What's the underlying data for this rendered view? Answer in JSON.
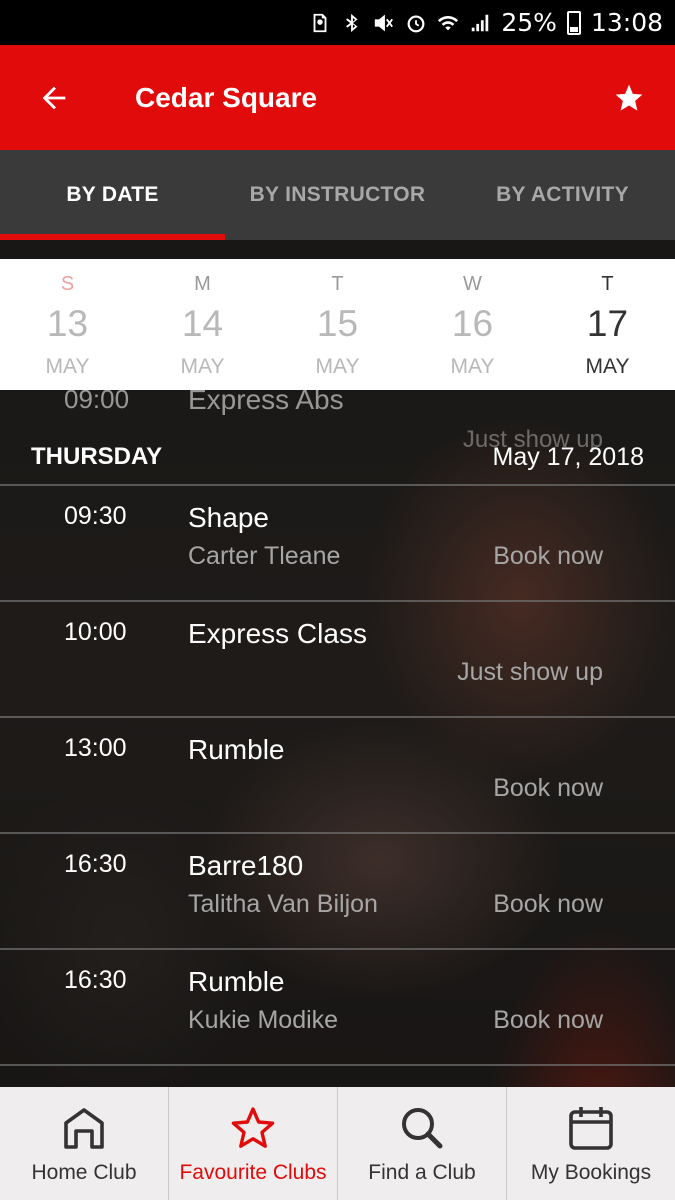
{
  "status_bar": {
    "battery": "25%",
    "time": "13:08",
    "icons": [
      "sim-alert-icon",
      "bluetooth-icon",
      "mute-icon",
      "alarm-icon",
      "wifi-icon",
      "signal-icon",
      "battery-icon"
    ]
  },
  "app_bar": {
    "title": "Cedar Square",
    "back_icon": "back-arrow-icon",
    "favourite_icon": "star-icon",
    "color": "#e10b0b"
  },
  "tabs": [
    {
      "label": "BY DATE",
      "active": true
    },
    {
      "label": "BY INSTRUCTOR",
      "active": false
    },
    {
      "label": "BY ACTIVITY",
      "active": false
    }
  ],
  "dates": [
    {
      "dow": "S",
      "day": "13",
      "month": "MAY"
    },
    {
      "dow": "M",
      "day": "14",
      "month": "MAY"
    },
    {
      "dow": "T",
      "day": "15",
      "month": "MAY"
    },
    {
      "dow": "W",
      "day": "16",
      "month": "MAY"
    },
    {
      "dow": "T",
      "day": "17",
      "month": "MAY",
      "selected": true
    }
  ],
  "schedule": {
    "previous_partial": {
      "time": "09:00",
      "name": "Express Abs",
      "action": "Just show up"
    },
    "day_name": "THURSDAY",
    "day_full": "May 17, 2018",
    "classes": [
      {
        "time": "09:30",
        "name": "Shape",
        "instructor": "Carter Tleane",
        "action": "Book now"
      },
      {
        "time": "10:00",
        "name": "Express Class",
        "instructor": "",
        "action": "Just show up"
      },
      {
        "time": "13:00",
        "name": "Rumble",
        "instructor": "",
        "action": "Book now"
      },
      {
        "time": "16:30",
        "name": "Barre180",
        "instructor": "Talitha Van Biljon",
        "action": "Book now"
      },
      {
        "time": "16:30",
        "name": "Rumble",
        "instructor": "Kukie Modike",
        "action": "Book now"
      }
    ]
  },
  "bottom_nav": [
    {
      "label": "Home Club",
      "icon": "home-icon",
      "active": false
    },
    {
      "label": "Favourite Clubs",
      "icon": "star-outline-icon",
      "active": true
    },
    {
      "label": "Find a Club",
      "icon": "search-icon",
      "active": false
    },
    {
      "label": "My Bookings",
      "icon": "calendar-icon",
      "active": false
    }
  ]
}
